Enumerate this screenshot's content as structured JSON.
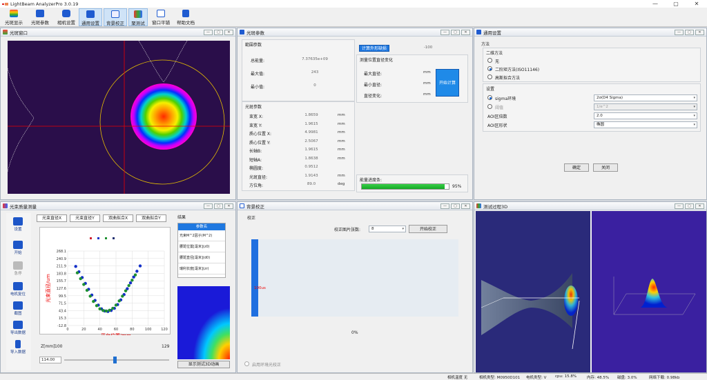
{
  "app": {
    "title": "LightBeam AnalyzerPro 3.0.19"
  },
  "toolbar": {
    "items": [
      "光斑显示",
      "光斑参数",
      "相机设置",
      "通用设置",
      "背景校正",
      "聚测试",
      "窗口平铺",
      "帮助文档"
    ]
  },
  "panels": {
    "beam_window": {
      "title": "光斑窗口"
    },
    "beam_params": {
      "title": "光斑参数",
      "range_group": "範圍参数",
      "total_energy_label": "总能量:",
      "total_energy": "7.37635e+09",
      "max_label": "最大值:",
      "max": "243",
      "min_label": "最小值:",
      "min": "0",
      "calc_btn_top": "计算外形缺损",
      "calc_value": "-100",
      "change_group": "测量位置直径变化",
      "max_diam_label": "最大直径:",
      "min_diam_label": "最小直径:",
      "diam_change_label": "直径变化:",
      "mm": "mm",
      "start_calc": "开始计算",
      "spot_group": "光斑参数",
      "rows": [
        {
          "label": "束宽 X:",
          "value": "1.8659",
          "unit": "mm"
        },
        {
          "label": "束宽 Y:",
          "value": "1.9615",
          "unit": "mm"
        },
        {
          "label": "质心位置 X:",
          "value": "4.9981",
          "unit": "mm"
        },
        {
          "label": "质心位置 Y:",
          "value": "2.5067",
          "unit": "mm"
        },
        {
          "label": "长轴B:",
          "value": "1.9615",
          "unit": "mm"
        },
        {
          "label": "短轴A:",
          "value": "1.8638",
          "unit": "mm"
        },
        {
          "label": "椭圆度:",
          "value": "0.9512",
          "unit": ""
        },
        {
          "label": "光斑直径:",
          "value": "1.9143",
          "unit": "mm"
        },
        {
          "label": "方位角:",
          "value": "89.0",
          "unit": "deg"
        }
      ],
      "energy_label": "能量进度条:",
      "energy_percent": "95%",
      "energy_fraction": 0.95
    },
    "general": {
      "title": "通用设置",
      "method": "方法",
      "second_moment": "二维方法",
      "opt_none": "无",
      "opt_second": "二阶矩方法(ISO11146)",
      "opt_fit": "高斯拟合方法",
      "settings": "设置",
      "sigma_label": "sigma环境",
      "sigma_value": "2σ(D4 Sigma)",
      "clip_label": "阈值",
      "clip_value": "1/e^2",
      "aoi_mult_label": "AOI区倍数",
      "aoi_mult": "2.0",
      "aoi_shape_label": "AOI区形状",
      "aoi_shape": "椭圆",
      "ok": "确定",
      "close": "关闭"
    },
    "quality": {
      "title": "光束质量测量",
      "tabs": [
        "光束直径X",
        "光束直径Y",
        "双曲拟合X",
        "双曲拟合Y"
      ],
      "result_title": "结果",
      "table_header": "参数名",
      "table_rows": [
        "光束M^2因子(M^2)",
        "腰斑位置[毫米](z0)",
        "腰斑直径[毫米](d0)",
        "瑞利长度[毫米](zr)"
      ],
      "side_buttons": [
        "设置",
        "开始",
        "急停",
        "电机复位",
        "截图",
        "导出数据",
        "导入数据"
      ],
      "ylabel": "光束直径/um",
      "xlabel": "平台位置/mm",
      "yticks": [
        "268.1",
        "240.9",
        "211.9",
        "183.8",
        "155.7",
        "127.6",
        "99.5",
        "71.5",
        "43.4",
        "15.3",
        "-12.8"
      ],
      "xticks": [
        "0",
        "20",
        "40",
        "60",
        "80",
        "100",
        "120"
      ],
      "z_label": "Z[mm]",
      "z_min": "100",
      "z_max": "129",
      "z_value": "114.00",
      "slider_fraction": 0.48,
      "show3d": "显示测试3D动画"
    },
    "background": {
      "title": "背景校正",
      "group": "校正",
      "frames_label": "校正图片张数:",
      "frames_value": "8",
      "start": "开始校正",
      "bar_label": "100us",
      "percent": "0%",
      "check_label": "启用环境光校正"
    },
    "view3d": {
      "title": "测试过程3D"
    }
  },
  "status": {
    "items": [
      "相机温度 无",
      "相机类型: M0950D101",
      "电机类型: V",
      "cpu: 15.8%",
      "内存: 48.5%",
      "磁盘: 3.0%",
      "网络下载: 0.98kb"
    ]
  },
  "chart_data": {
    "type": "scatter",
    "xlabel": "平台位置/mm",
    "ylabel": "光束直径/um",
    "ylim": [
      -12.8,
      268.1
    ],
    "series": [
      {
        "values": [
          [
            10,
            210
          ],
          [
            14,
            190
          ],
          [
            18,
            168
          ],
          [
            22,
            146
          ],
          [
            26,
            124
          ],
          [
            30,
            102
          ],
          [
            34,
            82
          ],
          [
            38,
            64
          ],
          [
            42,
            50
          ],
          [
            46,
            42
          ],
          [
            50,
            40
          ],
          [
            54,
            44
          ],
          [
            58,
            52
          ],
          [
            62,
            66
          ],
          [
            66,
            84
          ],
          [
            70,
            104
          ],
          [
            74,
            126
          ],
          [
            78,
            148
          ],
          [
            82,
            170
          ],
          [
            86,
            192
          ],
          [
            90,
            212
          ]
        ]
      },
      {
        "values": [
          [
            12,
            186
          ],
          [
            16,
            164
          ],
          [
            20,
            142
          ],
          [
            24,
            120
          ],
          [
            28,
            98
          ],
          [
            32,
            78
          ],
          [
            36,
            62
          ],
          [
            40,
            50
          ],
          [
            44,
            44
          ],
          [
            48,
            42
          ],
          [
            52,
            45
          ],
          [
            56,
            52
          ],
          [
            60,
            64
          ],
          [
            64,
            80
          ],
          [
            68,
            98
          ],
          [
            72,
            118
          ],
          [
            76,
            138
          ],
          [
            80,
            158
          ],
          [
            84,
            178
          ]
        ]
      }
    ],
    "colors": [
      "#1430c8",
      "#1e9030"
    ]
  }
}
